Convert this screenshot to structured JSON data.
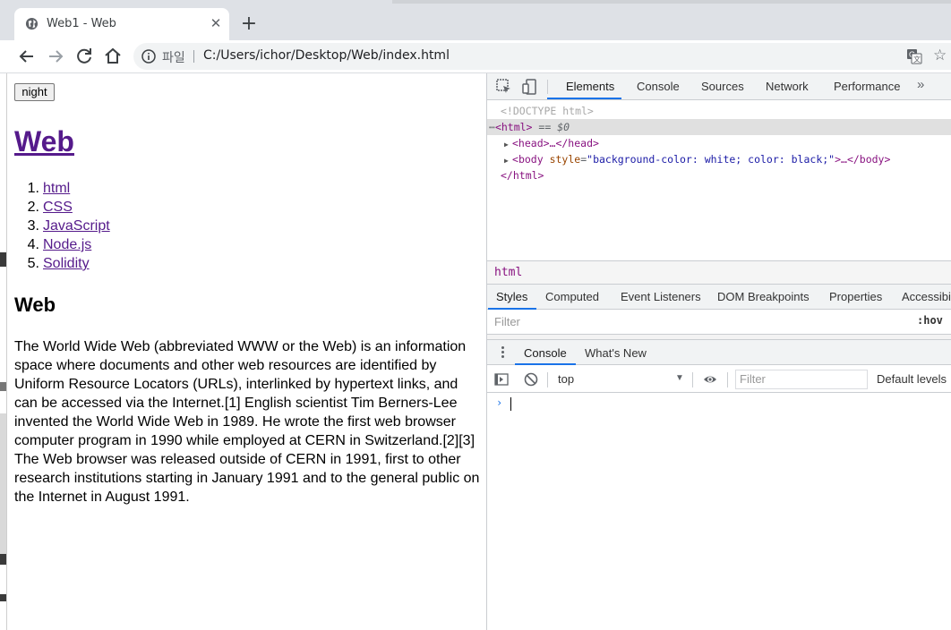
{
  "browser": {
    "tab_title": "Web1 - Web",
    "close_glyph": "✕",
    "newtab_glyph": "+",
    "scheme_label": "파일",
    "url": "C:/Users/ichor/Desktop/Web/index.html",
    "star_glyph": "☆",
    "icons": [
      "globe-icon",
      "back-arrow-icon",
      "forward-arrow-icon",
      "reload-icon",
      "home-icon",
      "info-icon",
      "translate-icon",
      "star-icon"
    ]
  },
  "page": {
    "night_button": "night",
    "heading": "Web",
    "topics": [
      {
        "num": "1.",
        "label": "html"
      },
      {
        "num": "2.",
        "label": "CSS"
      },
      {
        "num": "3.",
        "label": "JavaScript"
      },
      {
        "num": "4.",
        "label": "Node.js"
      },
      {
        "num": "5.",
        "label": "Solidity"
      }
    ],
    "subheading": "Web",
    "paragraph": "The World Wide Web (abbreviated WWW or the Web) is an information space where documents and other web resources are identified by Uniform Resource Locators (URLs), interlinked by hypertext links, and can be accessed via the Internet.[1] English scientist Tim Berners-Lee invented the World Wide Web in 1989. He wrote the first web browser computer program in 1990 while employed at CERN in Switzerland.[2][3] The Web browser was released outside of CERN in 1991, first to other research institutions starting in January 1991 and to the general public on the Internet in August 1991."
  },
  "devtools": {
    "tabs": [
      "Elements",
      "Console",
      "Sources",
      "Network",
      "Performance"
    ],
    "more_glyph": "»",
    "dom": {
      "doctype": "<!DOCTYPE html>",
      "html_open": "<html>",
      "html_selected_marker": "== $0",
      "head": "<head>…</head>",
      "body_tag": "body",
      "body_attr_name": "style",
      "body_attr_value": "\"background-color: white; color: black;\"",
      "body_rest": ">…</body>",
      "html_close": "</html>"
    },
    "breadcrumb": "html",
    "sub_tabs": [
      "Styles",
      "Computed",
      "Event Listeners",
      "DOM Breakpoints",
      "Properties",
      "Accessibility"
    ],
    "styles_filter_placeholder": "Filter",
    "hov_label": ":hov",
    "drawer_tabs": [
      "Console",
      "What's New"
    ],
    "console_context": "top",
    "console_filter_placeholder": "Filter",
    "levels_label": "Default levels",
    "prompt_glyph": "›",
    "accent_color": "#1a73e8"
  }
}
